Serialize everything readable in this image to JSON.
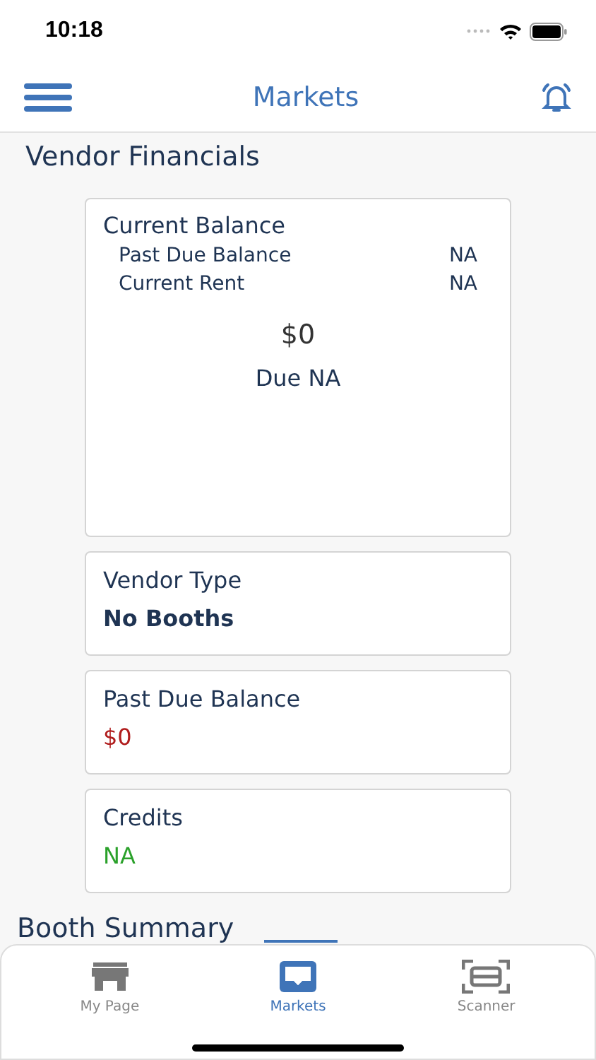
{
  "status_bar": {
    "time": "10:18"
  },
  "header": {
    "title": "Markets"
  },
  "section_title": "Vendor Financials",
  "balance_card": {
    "title": "Current Balance",
    "rows": [
      {
        "label": "Past Due Balance",
        "value": "NA"
      },
      {
        "label": "Current Rent",
        "value": "NA"
      }
    ],
    "amount": "$0",
    "due": "Due NA"
  },
  "cards": [
    {
      "title": "Vendor Type",
      "value": "No Booths",
      "color": "#1f3453"
    },
    {
      "title": "Past Due Balance",
      "value": "$0",
      "color": "#b01c1c"
    },
    {
      "title": "Credits",
      "value": "NA",
      "color": "#2aa12a"
    }
  ],
  "next_section_title": "Booth Summary",
  "tabs": [
    {
      "label": "My Page",
      "selected": false
    },
    {
      "label": "Markets",
      "selected": true
    },
    {
      "label": "Scanner",
      "selected": false
    }
  ]
}
